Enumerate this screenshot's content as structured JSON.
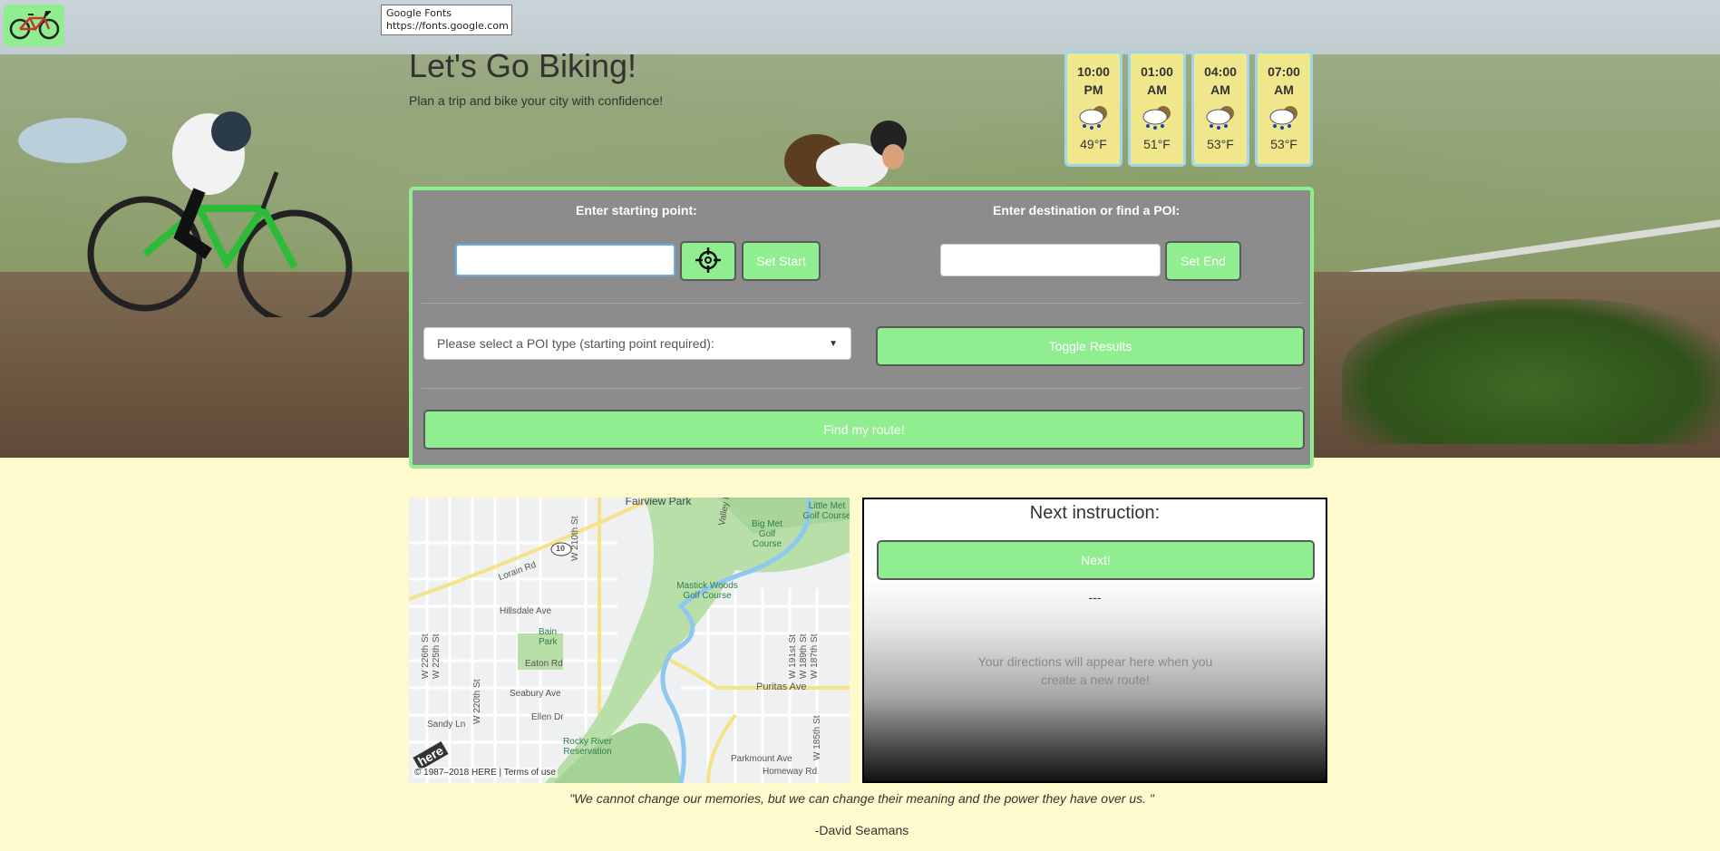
{
  "tooltip": {
    "line1": "Google Fonts",
    "line2": "https://fonts.google.com"
  },
  "header": {
    "title": "Let's Go Biking!",
    "subtitle": "Plan a trip and bike your city with confidence!",
    "logo_icon": "bicycle-icon"
  },
  "weather": [
    {
      "time": "10:00 PM",
      "temp": "49°F",
      "icon": "rain-cloud-icon"
    },
    {
      "time": "01:00 AM",
      "temp": "51°F",
      "icon": "rain-cloud-icon"
    },
    {
      "time": "04:00 AM",
      "temp": "53°F",
      "icon": "rain-cloud-icon"
    },
    {
      "time": "07:00 AM",
      "temp": "53°F",
      "icon": "rain-cloud-icon"
    }
  ],
  "form": {
    "start_label": "Enter starting point:",
    "start_value": "",
    "start_placeholder": "",
    "locate_icon": "crosshair-icon",
    "set_start": "Set Start",
    "dest_label": "Enter destination or find a POI:",
    "dest_value": "",
    "dest_placeholder": "",
    "set_end": "Set End",
    "poi_select": "Please select a POI type (starting point required):",
    "toggle_results": "Toggle Results",
    "find_route": "Find my route!"
  },
  "map": {
    "labels": {
      "fairview": "Fairview Park",
      "little_met": "Little Met Golf Course",
      "big_met": "Big Met Golf Course",
      "mastick": "Mastick Woods Golf Course",
      "lorain": "Lorain Rd",
      "hillsdale": "Hillsdale Ave",
      "bain": "Bain Park",
      "eaton": "Eaton Rd",
      "seabury": "Seabury Ave",
      "ellen": "Ellen Dr",
      "sandy": "Sandy Ln",
      "rocky": "Rocky River Reservation",
      "puritas": "Puritas Ave",
      "parkmount": "Parkmount Ave",
      "homeway": "Homeway Rd",
      "w210": "W 210th St",
      "w220": "W 220th St",
      "w191": "W 191st St",
      "w189": "W 189th St",
      "w187": "W 187th St",
      "w185": "W 185th St",
      "w226": "W 226th St",
      "w225": "W 225th St",
      "valley": "Valley Pkwy",
      "route10": "10",
      "here": "here"
    },
    "copyright": "© 1987–2018 HERE | Terms of use"
  },
  "instructions": {
    "heading": "Next instruction:",
    "next_button": "Next!",
    "current": "---",
    "placeholder": "Your directions will appear here when you create a new route!"
  },
  "quote": {
    "text": "\"We cannot change our memories, but we can change their meaning and the power they have over us. \"",
    "author": "-David Seamans"
  },
  "colors": {
    "accent_green": "#90ee90",
    "panel_gray": "#8c8c8c",
    "page_bg": "#fffacd",
    "weather_card": "#f0e68c",
    "weather_border": "#9fd6ee"
  }
}
